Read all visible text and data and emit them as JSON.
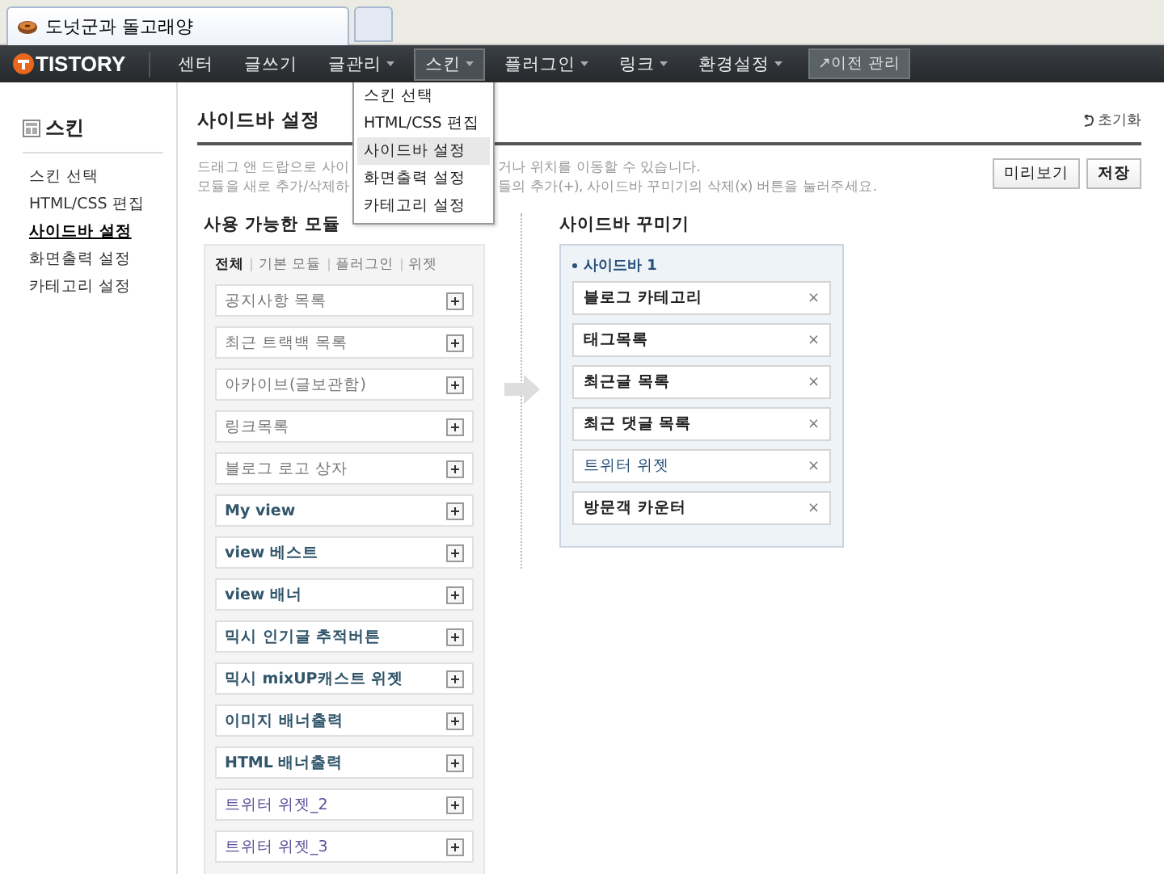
{
  "browser_tab": {
    "title": "도넛군과 돌고래양"
  },
  "nav": {
    "logo": "TISTORY",
    "items": [
      {
        "label": "센터",
        "dropdown": false,
        "selected": false
      },
      {
        "label": "글쓰기",
        "dropdown": false,
        "selected": false
      },
      {
        "label": "글관리",
        "dropdown": true,
        "selected": false
      },
      {
        "label": "스킨",
        "dropdown": true,
        "selected": true
      },
      {
        "label": "플러그인",
        "dropdown": true,
        "selected": false
      },
      {
        "label": "링크",
        "dropdown": true,
        "selected": false
      },
      {
        "label": "환경설정",
        "dropdown": true,
        "selected": false
      }
    ],
    "legacy_button": "↗이전 관리"
  },
  "dropdown_menu": [
    {
      "label": "스킨 선택",
      "selected": false
    },
    {
      "label": "HTML/CSS 편집",
      "selected": false
    },
    {
      "label": "사이드바 설정",
      "selected": true
    },
    {
      "label": "화면출력 설정",
      "selected": false
    },
    {
      "label": "카테고리 설정",
      "selected": false
    }
  ],
  "left_sidebar": {
    "title": "스킨",
    "items": [
      {
        "label": "스킨 선택",
        "selected": false
      },
      {
        "label": "HTML/CSS 편집",
        "selected": false
      },
      {
        "label": "사이드바 설정",
        "selected": true
      },
      {
        "label": "화면출력 설정",
        "selected": false
      },
      {
        "label": "카테고리 설정",
        "selected": false
      }
    ]
  },
  "page": {
    "title": "사이드바 설정",
    "reset_link": "초기화",
    "description_lines": [
      {
        "before_menu": "드래그 앤 드랍으로 사이",
        "after_menu": "거나 위치를 이동할 수 있습니다."
      },
      {
        "before_menu": "모듈을 새로 추가/삭제하",
        "after_menu": "들의 추가(+), 사이드바 꾸미기의 삭제(x) 버튼을 눌러주세요."
      }
    ],
    "buttons": [
      "미리보기",
      "저장"
    ]
  },
  "available_modules": {
    "title": "사용 가능한 모듈",
    "filters": [
      {
        "label": "전체",
        "selected": true
      },
      {
        "label": "기본 모듈",
        "selected": false
      },
      {
        "label": "플러그인",
        "selected": false
      },
      {
        "label": "위젯",
        "selected": false
      }
    ],
    "items": [
      {
        "label": "공지사항 목록",
        "kind": "basic"
      },
      {
        "label": "최근 트랙백 목록",
        "kind": "basic"
      },
      {
        "label": "아카이브(글보관함)",
        "kind": "basic"
      },
      {
        "label": "링크목록",
        "kind": "basic"
      },
      {
        "label": "블로그 로고 상자",
        "kind": "basic"
      },
      {
        "label": "My view",
        "kind": "plugin"
      },
      {
        "label": "view 베스트",
        "kind": "plugin"
      },
      {
        "label": "view 배너",
        "kind": "plugin"
      },
      {
        "label": "믹시 인기글 추적버튼",
        "kind": "plugin"
      },
      {
        "label": "믹시 mixUP캐스트 위젯",
        "kind": "plugin"
      },
      {
        "label": "이미지 배너출력",
        "kind": "plugin"
      },
      {
        "label": "HTML 배너출력",
        "kind": "plugin"
      },
      {
        "label": "트위터 위젯_2",
        "kind": "widget"
      },
      {
        "label": "트위터 위젯_3",
        "kind": "widget"
      }
    ]
  },
  "sidebar_decorator": {
    "title": "사이드바 꾸미기",
    "sidebar_name": "사이드바 1",
    "items": [
      {
        "label": "블로그 카테고리",
        "kind": "basic"
      },
      {
        "label": "태그목록",
        "kind": "basic"
      },
      {
        "label": "최근글 목록",
        "kind": "basic"
      },
      {
        "label": "최근 댓글 목록",
        "kind": "basic"
      },
      {
        "label": "트위터 위젯",
        "kind": "widget"
      },
      {
        "label": "방문객 카운터",
        "kind": "basic"
      }
    ],
    "remove_symbol": "×"
  }
}
